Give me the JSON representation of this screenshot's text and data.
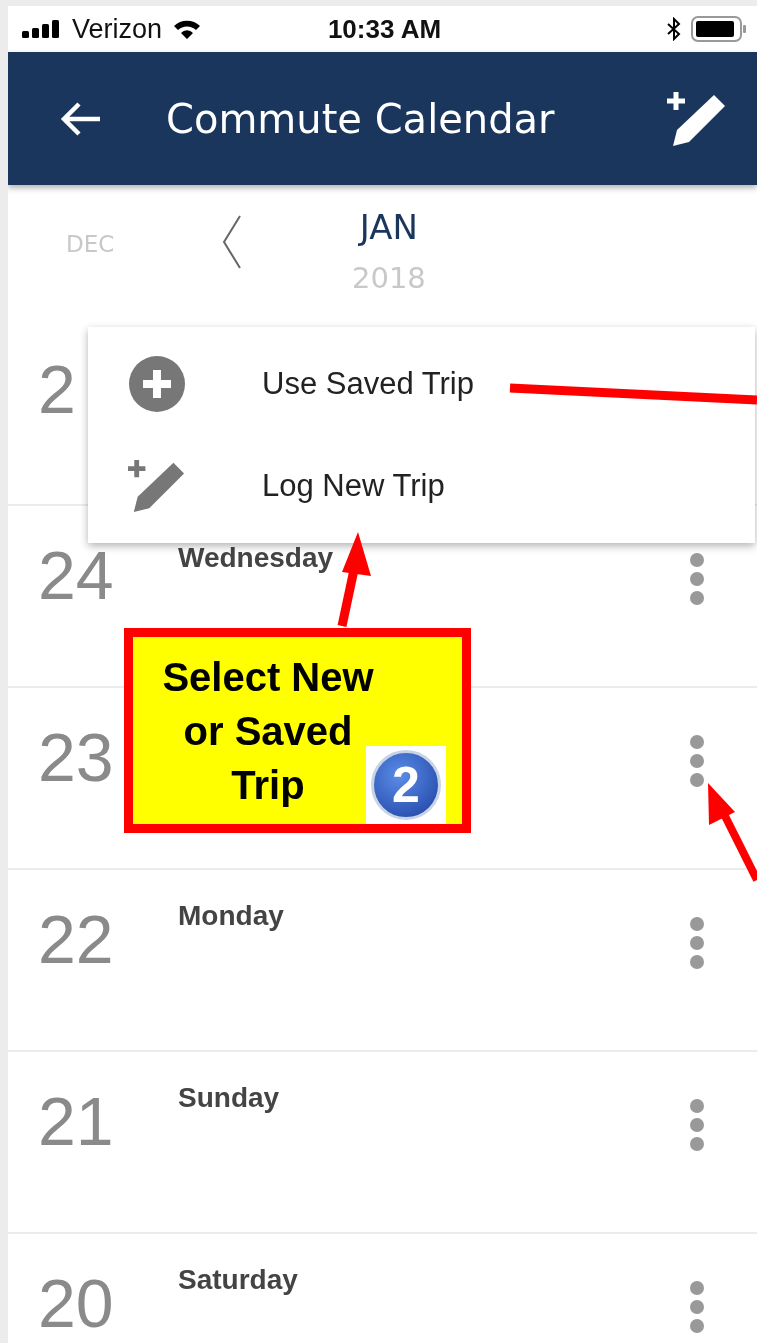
{
  "status_bar": {
    "carrier": "Verizon",
    "time": "10:33 AM"
  },
  "header": {
    "title": "Commute Calendar"
  },
  "month_nav": {
    "previous": "DEC",
    "current": "JAN",
    "year": "2018"
  },
  "days": [
    {
      "day": "2"
    },
    {
      "day": "24",
      "weekday": "Wednesday"
    },
    {
      "day": "23"
    },
    {
      "day": "22",
      "weekday": "Monday"
    },
    {
      "day": "21",
      "weekday": "Sunday"
    },
    {
      "day": "20",
      "weekday": "Saturday"
    }
  ],
  "menu": {
    "items": [
      {
        "label": "Use Saved Trip",
        "kind": "saved"
      },
      {
        "label": "Log New Trip",
        "kind": "new"
      }
    ]
  },
  "callout": {
    "text": "Select New or Saved Trip",
    "step": "2"
  }
}
